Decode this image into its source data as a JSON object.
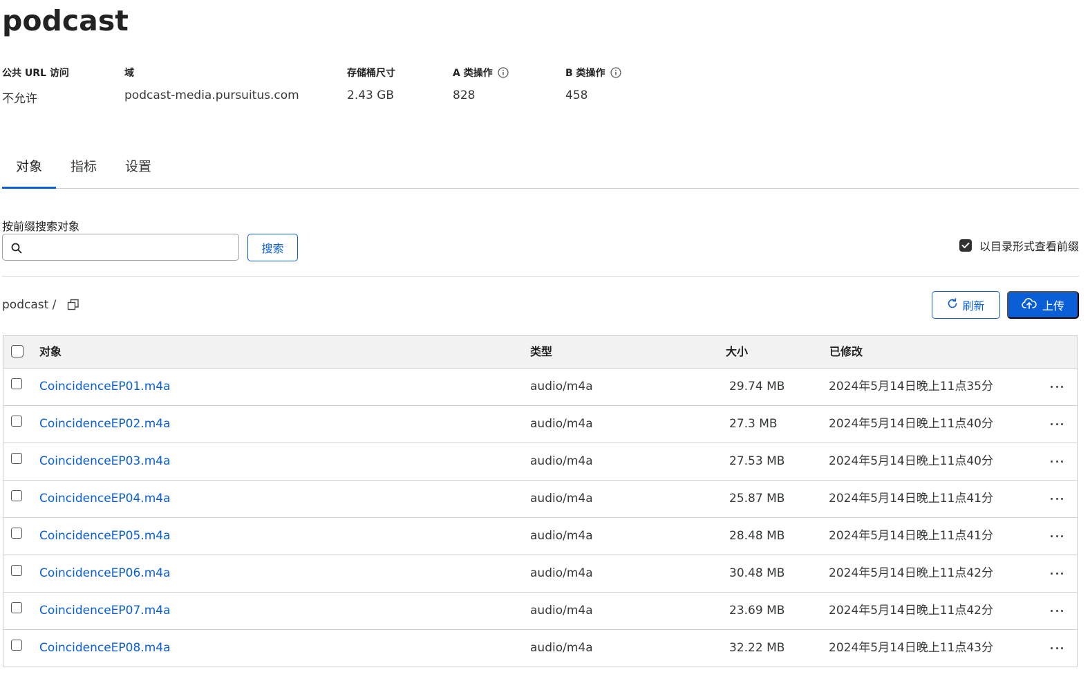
{
  "bucket": {
    "title": "podcast"
  },
  "stats": [
    {
      "label": "公共 URL 访问",
      "value": "不允许",
      "info": false
    },
    {
      "label": "域",
      "value": "podcast-media.pursuitus.com",
      "info": false
    },
    {
      "label": "存储桶尺寸",
      "value": "2.43 GB",
      "info": false
    },
    {
      "label": "A 类操作",
      "value": "828",
      "info": true,
      "icon": "info-icon"
    },
    {
      "label": "B 类操作",
      "value": "458",
      "info": true,
      "icon": "info-icon"
    }
  ],
  "tabs": [
    {
      "label": "对象",
      "active": true
    },
    {
      "label": "指标",
      "active": false
    },
    {
      "label": "设置",
      "active": false
    }
  ],
  "search": {
    "label": "按前缀搜索对象",
    "value": "",
    "placeholder": "",
    "button_label": "搜索",
    "icon": "search-icon"
  },
  "directory_toggle": {
    "label": "以目录形式查看前缀",
    "checked": true
  },
  "breadcrumb": {
    "path": "podcast /",
    "copy_icon": "copy-icon"
  },
  "actions": {
    "refresh_label": "刷新",
    "refresh_icon": "refresh-icon",
    "upload_label": "上传",
    "upload_icon": "cloud-upload-icon"
  },
  "table": {
    "headers": {
      "object": "对象",
      "type": "类型",
      "size": "大小",
      "modified": "已修改"
    },
    "rows": [
      {
        "name": "CoincidenceEP01.m4a",
        "type": "audio/m4a",
        "size": "29.74 MB",
        "modified": "2024年5月14日晚上11点35分"
      },
      {
        "name": "CoincidenceEP02.m4a",
        "type": "audio/m4a",
        "size": "27.3 MB",
        "modified": "2024年5月14日晚上11点40分"
      },
      {
        "name": "CoincidenceEP03.m4a",
        "type": "audio/m4a",
        "size": "27.53 MB",
        "modified": "2024年5月14日晚上11点40分"
      },
      {
        "name": "CoincidenceEP04.m4a",
        "type": "audio/m4a",
        "size": "25.87 MB",
        "modified": "2024年5月14日晚上11点41分"
      },
      {
        "name": "CoincidenceEP05.m4a",
        "type": "audio/m4a",
        "size": "28.48 MB",
        "modified": "2024年5月14日晚上11点41分"
      },
      {
        "name": "CoincidenceEP06.m4a",
        "type": "audio/m4a",
        "size": "30.48 MB",
        "modified": "2024年5月14日晚上11点42分"
      },
      {
        "name": "CoincidenceEP07.m4a",
        "type": "audio/m4a",
        "size": "23.69 MB",
        "modified": "2024年5月14日晚上11点42分"
      },
      {
        "name": "CoincidenceEP08.m4a",
        "type": "audio/m4a",
        "size": "32.22 MB",
        "modified": "2024年5月14日晚上11点43分"
      }
    ]
  },
  "colors": {
    "accent": "#0a5fd6",
    "text": "#36393a",
    "header_bg": "#f2f2f2",
    "border": "#cfcfcf"
  }
}
